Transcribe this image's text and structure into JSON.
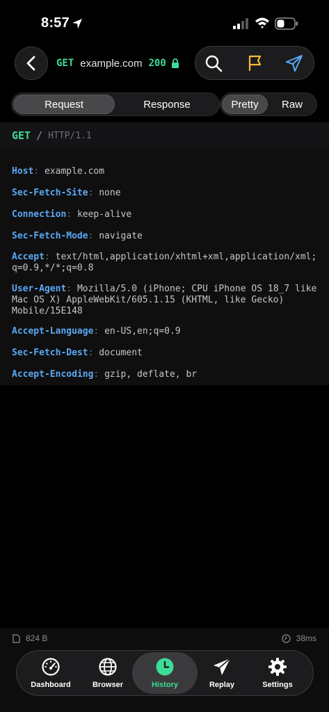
{
  "status_bar": {
    "time": "8:57"
  },
  "header": {
    "method": "GET",
    "host": "example.com",
    "status_code": "200"
  },
  "tabs": {
    "request": "Request",
    "response": "Response",
    "selected": "Request"
  },
  "view_modes": {
    "pretty": "Pretty",
    "raw": "Raw",
    "selected": "Pretty"
  },
  "request_line": {
    "method": "GET",
    "path": "/",
    "protocol": "HTTP/1.1"
  },
  "headers": [
    {
      "key": "Host",
      "value": "example.com"
    },
    {
      "key": "Sec-Fetch-Site",
      "value": "none"
    },
    {
      "key": "Connection",
      "value": "keep-alive"
    },
    {
      "key": "Sec-Fetch-Mode",
      "value": "navigate"
    },
    {
      "key": "Accept",
      "value": "text/html,application/xhtml+xml,application/xml;q=0.9,*/*;q=0.8"
    },
    {
      "key": "User-Agent",
      "value": "Mozilla/5.0 (iPhone; CPU iPhone OS 18_7 like Mac OS X) AppleWebKit/605.1.15 (KHTML, like Gecko) Mobile/15E148"
    },
    {
      "key": "Accept-Language",
      "value": "en-US,en;q=0.9"
    },
    {
      "key": "Sec-Fetch-Dest",
      "value": "document"
    },
    {
      "key": "Accept-Encoding",
      "value": "gzip, deflate, br"
    }
  ],
  "footer": {
    "size": "824 B",
    "duration": "38ms"
  },
  "tab_bar": {
    "items": [
      {
        "label": "Dashboard",
        "icon": "gauge-icon"
      },
      {
        "label": "Browser",
        "icon": "globe-icon"
      },
      {
        "label": "History",
        "icon": "clock-icon"
      },
      {
        "label": "Replay",
        "icon": "paper-plane-icon"
      },
      {
        "label": "Settings",
        "icon": "gear-icon"
      }
    ],
    "selected": "History"
  },
  "colors": {
    "accent_green": "#3ddc97",
    "header_key_blue": "#5aa9f5",
    "flag_yellow": "#f5b93d",
    "send_blue": "#5aa9f5"
  }
}
